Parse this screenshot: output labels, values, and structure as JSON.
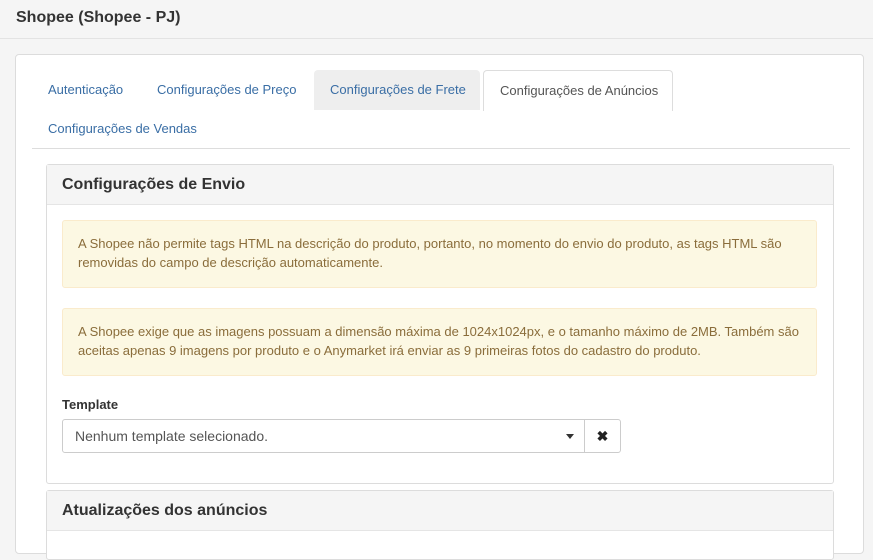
{
  "header": {
    "title": "Shopee (Shopee - PJ)"
  },
  "tabs": [
    {
      "label": "Autenticação"
    },
    {
      "label": "Configurações de Preço"
    },
    {
      "label": "Configurações de Frete"
    },
    {
      "label": "Configurações de Anúncios"
    },
    {
      "label": "Configurações de Vendas"
    }
  ],
  "active_tab": "Configurações de Anúncios",
  "envio": {
    "title": "Configurações de Envio",
    "alert1": "A Shopee não permite tags HTML na descrição do produto, portanto, no momento do envio do produto, as tags HTML são removidas do campo de descrição automaticamente.",
    "alert2": "A Shopee exige que as imagens possuam a dimensão máxima de 1024x1024px, e o tamanho máximo de 2MB. Também são aceitas apenas 9 imagens por produto e o Anymarket irá enviar as 9 primeiras fotos do cadastro do produto.",
    "template_label": "Template",
    "template_value": "Nenhum template selecionado.",
    "clear_icon": "times-icon"
  },
  "atualizacoes": {
    "title": "Atualizações dos anúncios"
  },
  "colors": {
    "link": "#3a6ea5",
    "alert_bg": "#fcf8e3",
    "alert_text": "#8a6d3b"
  }
}
